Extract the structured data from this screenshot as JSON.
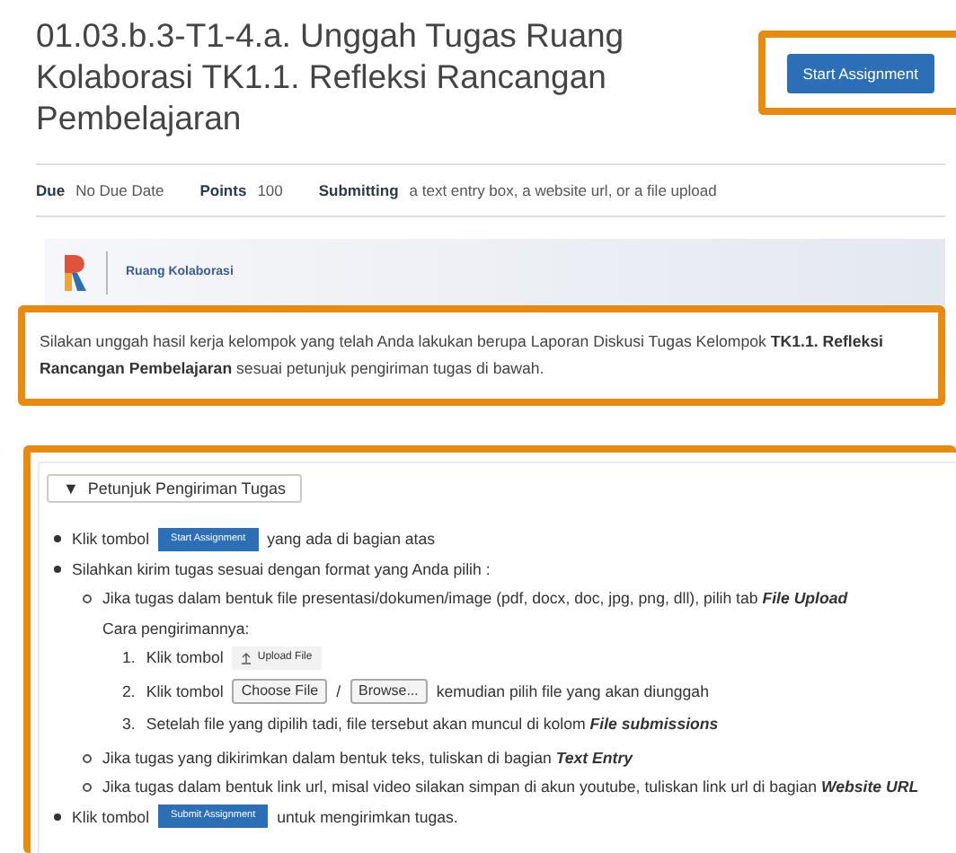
{
  "title": "01.03.b.3-T1-4.a. Unggah Tugas Ruang Kolaborasi TK1.1. Refleksi Rancangan Pembelajaran",
  "start_button": {
    "label": "Start Assignment",
    "highlighted": true
  },
  "meta": [
    {
      "label": "Due",
      "value": "No Due Date"
    },
    {
      "label": "Points",
      "value": "100"
    },
    {
      "label": "Submitting",
      "value": "a text entry box, a website url, or a file upload"
    }
  ],
  "banner": {
    "label": "Ruang Kolaborasi"
  },
  "intro": {
    "text": "Silakan unggah hasil kerja kelompok yang telah Anda lakukan berupa Laporan Diskusi Tugas Kelompok **TK1.1. Refleksi Rancangan Pembelajaran** sesuai petunjuk pengiriman tugas di bawah.",
    "highlighted": true
  },
  "instructions": {
    "highlighted": true,
    "toggle": {
      "icon": "▼",
      "label": "Petunjuk Pengiriman Tugas"
    },
    "items": [
      {
        "segments": [
          {
            "kind": "text",
            "text": "Klik tombol"
          },
          {
            "kind": "button",
            "text": "Start Assignment"
          },
          {
            "kind": "text",
            "text": "yang ada di bagian atas"
          }
        ]
      },
      {
        "segments": [
          {
            "kind": "text",
            "text": "Silahkan kirim tugas sesuai dengan format yang Anda pilih :"
          }
        ],
        "children": [
          {
            "segments": [
              {
                "kind": "text",
                "text": "Jika tugas dalam bentuk file presentasi/dokumen/image (pdf, docx, doc, jpg, png, dll), pilih tab **File Upload**"
              }
            ],
            "note": "Cara pengirimannya:",
            "steps": [
              {
                "number": "1.",
                "segments": [
                  {
                    "kind": "text",
                    "text": "Klik tombol"
                  },
                  {
                    "kind": "upload",
                    "text": "Upload File"
                  }
                ]
              },
              {
                "number": "2.",
                "segments": [
                  {
                    "kind": "text",
                    "text": "Klik tombol"
                  },
                  {
                    "kind": "file",
                    "text": "Choose File"
                  },
                  {
                    "kind": "text",
                    "text": "/"
                  },
                  {
                    "kind": "file",
                    "text": "Browse..."
                  },
                  {
                    "kind": "text",
                    "text": "kemudian pilih file yang akan diunggah"
                  }
                ]
              },
              {
                "number": "3.",
                "segments": [
                  {
                    "kind": "text",
                    "text": "Setelah file yang dipilih tadi, file tersebut akan muncul di kolom **File submissions**"
                  }
                ]
              }
            ]
          },
          {
            "segments": [
              {
                "kind": "text",
                "text": "Jika tugas yang dikirimkan dalam bentuk teks, tuliskan di bagian **Text Entry**"
              }
            ]
          },
          {
            "segments": [
              {
                "kind": "text",
                "text": "Jika tugas dalam bentuk link url, misal video silakan simpan di akun youtube, tuliskan link url di bagian **Website URL**"
              }
            ]
          }
        ]
      },
      {
        "segments": [
          {
            "kind": "text",
            "text": "Klik tombol"
          },
          {
            "kind": "button",
            "text": "Submit Assignment"
          },
          {
            "kind": "text",
            "text": "untuk mengirimkan tugas."
          }
        ]
      }
    ]
  }
}
